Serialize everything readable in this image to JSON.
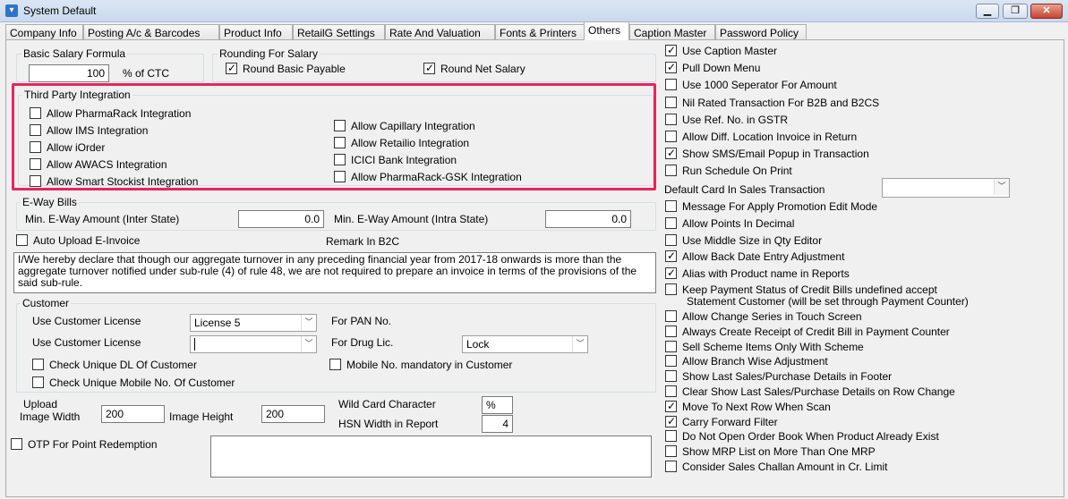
{
  "window": {
    "title": "System Default",
    "minimize": "▁",
    "restore": "❐",
    "close": "✕"
  },
  "tabs": [
    "Company Info",
    "Posting A/c & Barcodes",
    "Product Info",
    "RetailG Settings",
    "Rate And Valuation",
    "Fonts & Printers",
    "Others",
    "Caption Master",
    "Password Policy"
  ],
  "active_tab": "Others",
  "salary": {
    "title": "Basic Salary Formula",
    "value": "100",
    "unit": "% of CTC"
  },
  "rounding": {
    "title": "Rounding For Salary",
    "basic": "Round Basic Payable",
    "net": "Round Net Salary"
  },
  "third_party": {
    "title": "Third Party Integration",
    "left": [
      "Allow PharmaRack Integration",
      "Allow IMS Integration",
      "Allow iOrder",
      "Allow AWACS Integration",
      "Allow Smart Stockist Integration"
    ],
    "right": [
      "Allow Capillary Integration",
      "Allow Retailio Integration",
      "ICICI Bank Integration",
      "Allow PharmaRack-GSK Integration"
    ]
  },
  "eway": {
    "title": "E-Way Bills",
    "inter_label": "Min. E-Way Amount (Inter State)",
    "inter_value": "0.0",
    "intra_label": "Min. E-Way Amount (Intra State)",
    "intra_value": "0.0"
  },
  "auto_upload": "Auto Upload E-Invoice",
  "remark_label": "Remark In B2C",
  "declaration": "I/We hereby declare that though our aggregate turnover in any preceding financial year from 2017-18 onwards is more than the aggregate turnover notified under sub-rule (4) of rule 48, we are not required to prepare an invoice in terms of the provisions of the said sub-rule.",
  "customer": {
    "title": "Customer",
    "license1_label": "Use Customer License",
    "license1_value": "License 5",
    "license2_label": "Use Customer License",
    "license2_value": "",
    "pan_label": "For PAN No.",
    "drug_label": "For Drug Lic.",
    "drug_value": "Lock",
    "unique_dl": "Check Unique DL Of Customer",
    "unique_mobile": "Check Unique Mobile No. Of Customer",
    "mobile_mandatory": "Mobile No. mandatory in Customer"
  },
  "upload": {
    "title": "Upload",
    "width_label": "Image Width",
    "width_value": "200",
    "height_label": "Image Height",
    "height_value": "200"
  },
  "wildcard": {
    "label": "Wild Card Character",
    "value": "%"
  },
  "hsn": {
    "label": "HSN Width in Report",
    "value": "4"
  },
  "otp": "OTP For Point Redemption",
  "default_card_label": "Default Card In Sales Transaction",
  "default_card_value": "",
  "right_options": [
    {
      "label": "Use Caption Master",
      "checked": true
    },
    {
      "label": "Pull Down Menu",
      "checked": true
    },
    {
      "label": "Use 1000 Seperator For Amount",
      "checked": false
    },
    {
      "label": "Nil Rated Transaction For B2B and B2CS",
      "checked": false
    },
    {
      "label": "Use Ref. No. in GSTR",
      "checked": false
    },
    {
      "label": "Allow Diff. Location Invoice in Return",
      "checked": false
    },
    {
      "label": "Show SMS/Email Popup in Transaction",
      "checked": true
    },
    {
      "label": "Run Schedule On Print",
      "checked": false
    }
  ],
  "right_options2": [
    {
      "label": "Message For Apply Promotion Edit Mode",
      "checked": false
    },
    {
      "label": "Allow Points In Decimal",
      "checked": false
    },
    {
      "label": "Use Middle Size in Qty Editor",
      "checked": false
    },
    {
      "label": "Allow Back Date Entry Adjustment",
      "checked": true
    },
    {
      "label": "Alias with Product name in Reports",
      "checked": true
    }
  ],
  "keep_payment": {
    "line1": "Keep Payment Status of Credit Bills undefined accept",
    "line2": "Statement Customer (will be set through Payment Counter)"
  },
  "right_options3": [
    {
      "label": "Allow Change Series in Touch Screen",
      "checked": false
    },
    {
      "label": "Always Create Receipt of Credit Bill in Payment Counter",
      "checked": false
    },
    {
      "label": "Sell Scheme Items Only With Scheme",
      "checked": false
    },
    {
      "label": "Allow Branch Wise Adjustment",
      "checked": false
    },
    {
      "label": "Show Last Sales/Purchase Details in Footer",
      "checked": false
    },
    {
      "label": "Clear Show Last Sales/Purchase Details on Row Change",
      "checked": false
    },
    {
      "label": "Move To Next Row When Scan",
      "checked": true
    },
    {
      "label": "Carry Forward Filter",
      "checked": true
    },
    {
      "label": "Do Not Open Order Book When Product Already Exist",
      "checked": false
    },
    {
      "label": "Show MRP List on More Than One MRP",
      "checked": false
    },
    {
      "label": "Consider Sales Challan Amount in Cr. Limit",
      "checked": false
    }
  ]
}
